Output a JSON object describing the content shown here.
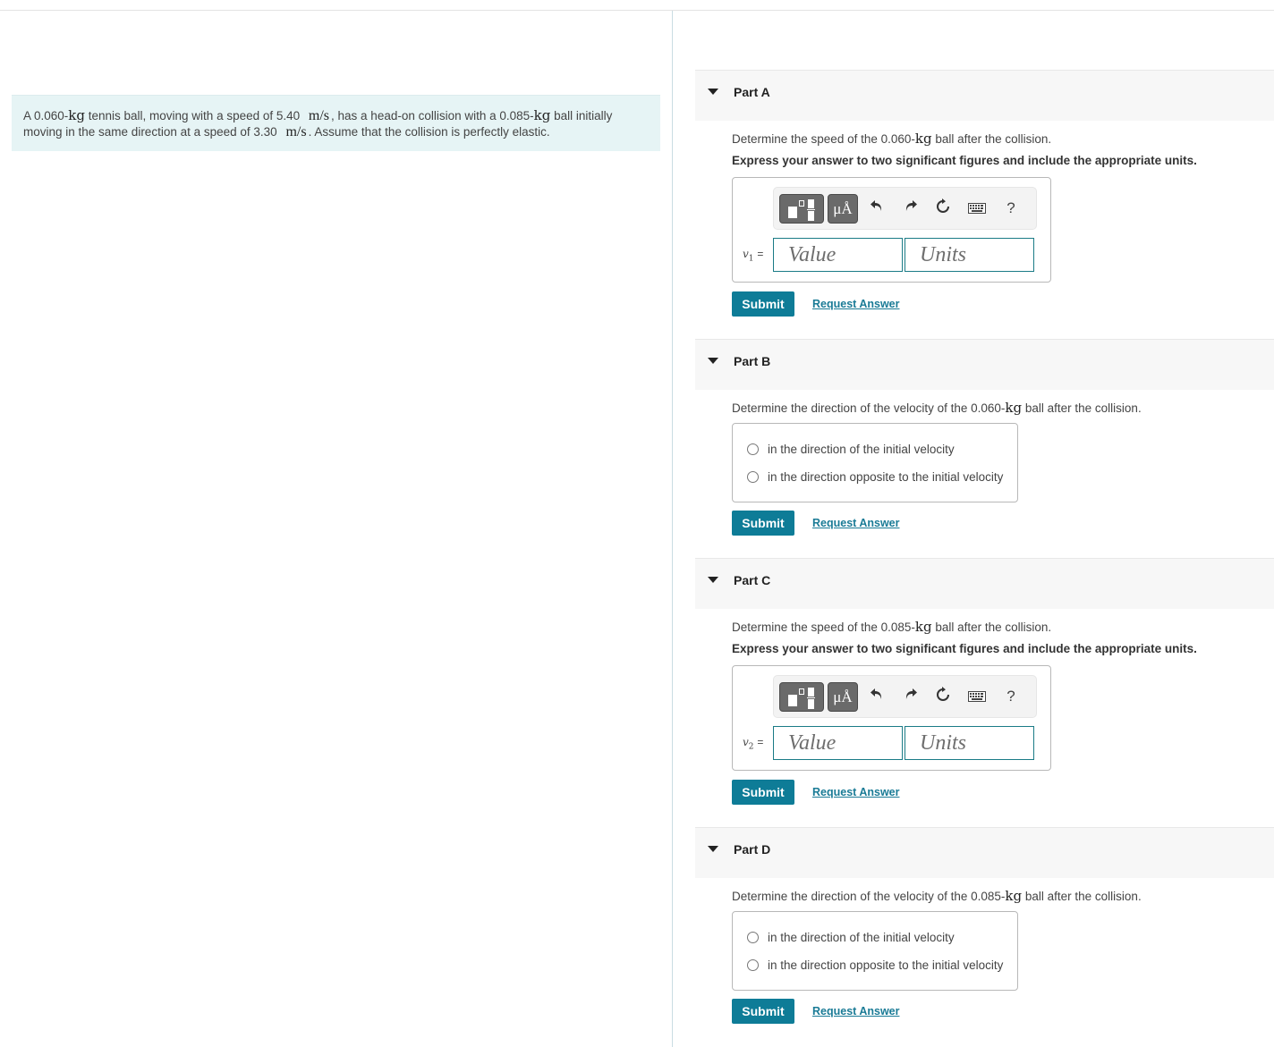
{
  "problem": {
    "segments": [
      {
        "t": "A 0.060-",
        "math": false
      },
      {
        "t": "kg",
        "math": true
      },
      {
        "t": " tennis ball, moving with a speed of 5.40 ",
        "math": false
      },
      {
        "t": "m/s",
        "math": "unit"
      },
      {
        "t": ", has a head-on collision with a 0.085-",
        "math": false
      },
      {
        "t": "kg",
        "math": true
      },
      {
        "t": " ball initially moving in the same direction at a speed of 3.30 ",
        "math": false
      },
      {
        "t": "m/s",
        "math": "unit"
      },
      {
        "t": ". Assume that the collision is perfectly elastic.",
        "math": false
      }
    ]
  },
  "toolbar": {
    "templates_icon": "templates-icon",
    "units_label": "μÅ",
    "undo_icon": "undo-icon",
    "redo_icon": "redo-icon",
    "reset_icon": "reset-icon",
    "keyboard_icon": "keyboard-icon",
    "help_label": "?"
  },
  "common": {
    "submit_label": "Submit",
    "request_answer_label": "Request Answer",
    "value_placeholder": "Value",
    "units_placeholder": "Units",
    "express_instruction": "Express your answer to two significant figures and include the appropriate units.",
    "choices": [
      "in the direction of the initial velocity",
      "in the direction opposite to the initial velocity"
    ]
  },
  "parts": [
    {
      "title": "Part A",
      "prompt_pre": "Determine the speed of the 0.060-",
      "prompt_math": "kg",
      "prompt_post": " ball after the collision.",
      "variable": "v",
      "subscript": "1",
      "type": "numeric"
    },
    {
      "title": "Part B",
      "prompt_pre": "Determine the direction of the velocity of the 0.060-",
      "prompt_math": "kg",
      "prompt_post": " ball after the collision.",
      "type": "choice"
    },
    {
      "title": "Part C",
      "prompt_pre": "Determine the speed of the 0.085-",
      "prompt_math": "kg",
      "prompt_post": " ball after the collision.",
      "variable": "v",
      "subscript": "2",
      "type": "numeric"
    },
    {
      "title": "Part D",
      "prompt_pre": "Determine the direction of the velocity of the 0.085-",
      "prompt_math": "kg",
      "prompt_post": " ball after the collision.",
      "type": "choice"
    }
  ],
  "colors": {
    "accent": "#0e7c97",
    "input_border": "#1a7b86",
    "problem_bg": "#e6f4f5",
    "header_bg": "#f7f7f7"
  }
}
